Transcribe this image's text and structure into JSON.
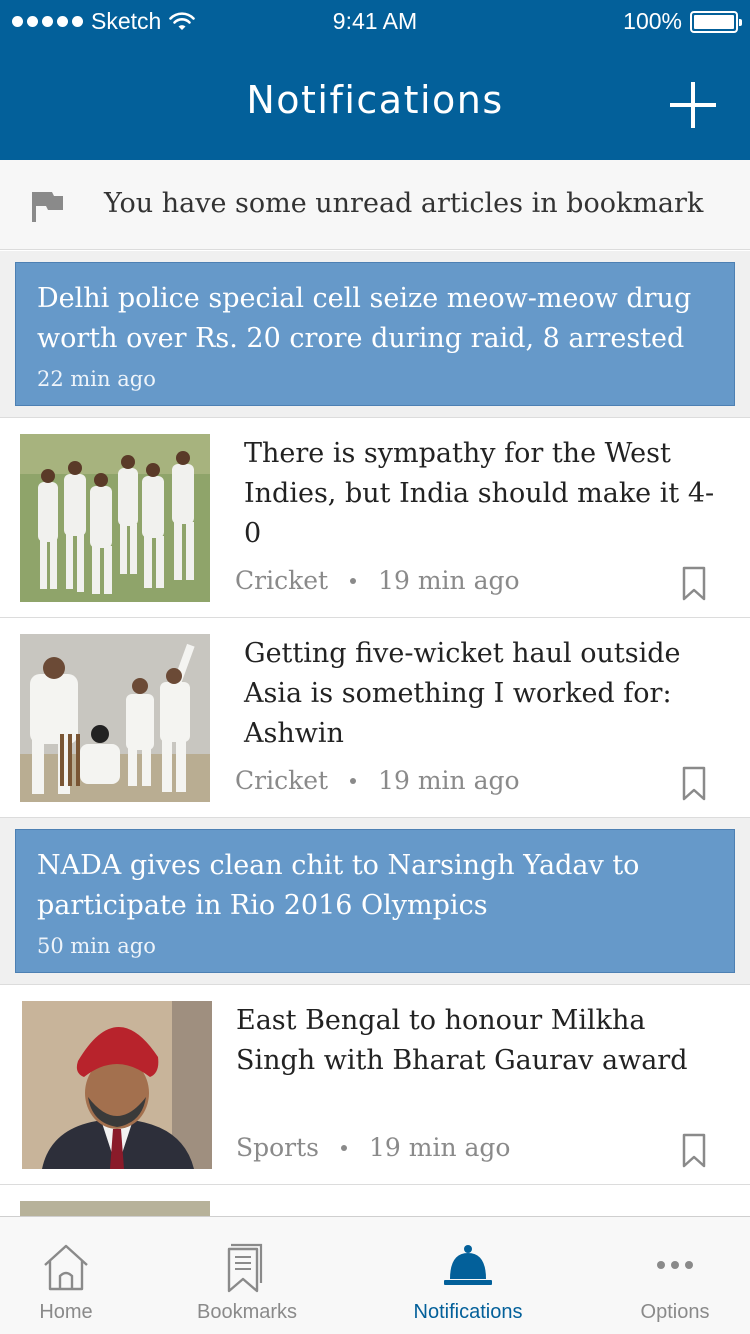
{
  "status_bar": {
    "carrier": "Sketch",
    "time": "9:41 AM",
    "battery": "100%"
  },
  "header": {
    "title": "Notifications",
    "add_icon": "plus-icon"
  },
  "unread_banner": {
    "icon": "flag-icon",
    "text": "You have some unread articles in bookmark"
  },
  "feed": {
    "items": [
      {
        "kind": "highlight",
        "headline": "Delhi police special cell seize meow-meow drug worth over Rs. 20 crore during raid, 8 arrested",
        "time": "22 min ago"
      },
      {
        "kind": "article",
        "headline": "There is sympathy for the West Indies, but India should make it 4-0",
        "category": "Cricket",
        "time": "19 min ago",
        "thumbnail": "cricket-team-walking-image"
      },
      {
        "kind": "article",
        "headline": "Getting five-wicket haul outside Asia is something I worked for: Ashwin",
        "category": "Cricket",
        "time": "19 min ago",
        "thumbnail": "cricket-bowler-celebration-image"
      },
      {
        "kind": "highlight",
        "headline": "NADA gives clean chit to Narsingh Yadav to participate in Rio 2016 Olympics",
        "time": "50 min ago"
      },
      {
        "kind": "article",
        "headline": "East Bengal to honour Milkha Singh with Bharat Gaurav award",
        "category": "Sports",
        "time": "19 min ago",
        "thumbnail": "milkha-singh-portrait-image"
      }
    ]
  },
  "tabbar": {
    "tabs": [
      {
        "label": "Home",
        "icon": "home-icon"
      },
      {
        "label": "Bookmarks",
        "icon": "bookmarks-icon"
      },
      {
        "label": "Notifications",
        "icon": "bell-icon",
        "active": true
      },
      {
        "label": "Options",
        "icon": "more-dots-icon"
      }
    ]
  },
  "colors": {
    "brand": "#03609a",
    "highlight": "#6699c9",
    "muted_text": "#8a8a8a"
  }
}
